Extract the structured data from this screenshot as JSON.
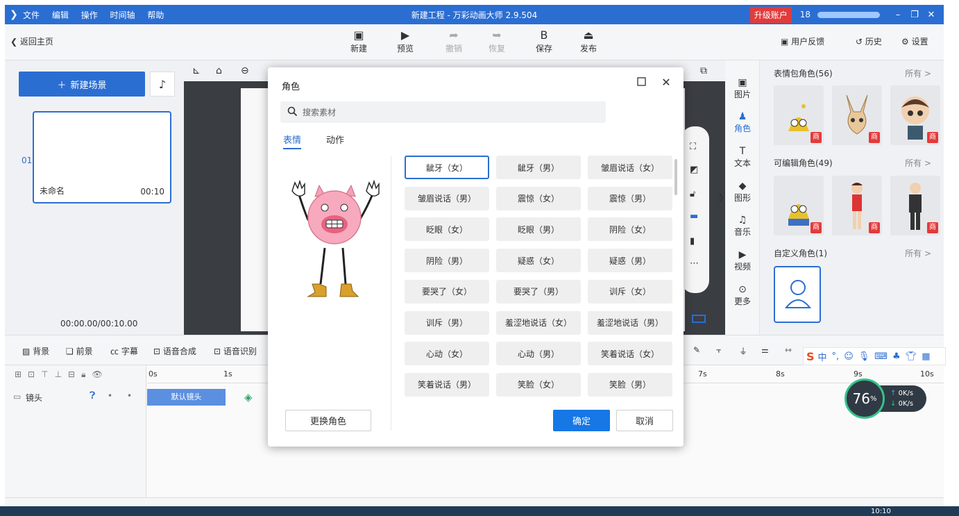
{
  "titlebar": {
    "menu": [
      "文件",
      "编辑",
      "操作",
      "时间轴",
      "帮助"
    ],
    "title": "新建工程 - 万彩动画大师 2.9.504",
    "upgrade": "升级账户",
    "phone": "18"
  },
  "toolbar": {
    "back": "返回主页",
    "tools": [
      {
        "label": "新建",
        "icon": "new-file-icon"
      },
      {
        "label": "预览",
        "icon": "play-icon"
      },
      {
        "label": "撤销",
        "icon": "undo-icon"
      },
      {
        "label": "恢复",
        "icon": "redo-icon"
      },
      {
        "label": "保存",
        "icon": "save-icon"
      },
      {
        "label": "发布",
        "icon": "publish-icon"
      }
    ],
    "feedback": "用户反馈",
    "history": "历史",
    "settings": "设置"
  },
  "scene_panel": {
    "new_scene": "新建场景",
    "scene_number": "01",
    "scene_name": "未命名",
    "scene_duration": "00:10",
    "timecode": "00:00.00/00:10.00"
  },
  "icon_strip": [
    "图片",
    "角色",
    "文本",
    "图形",
    "音乐",
    "视频",
    "更多"
  ],
  "library": {
    "section1": "表情包角色(56)",
    "section2": "可编辑角色(49)",
    "section3": "自定义角色(1)",
    "all": "所有 >",
    "shop_badge": "商"
  },
  "timeline": {
    "tools": [
      "背景",
      "前景",
      "字幕",
      "语音合成",
      "语音识别"
    ],
    "ticks": [
      "0s",
      "1s",
      "7s",
      "8s",
      "9s",
      "10s"
    ],
    "camera_row": "镜头",
    "camera_clip": "默认镜头"
  },
  "ime": {
    "lang": "中"
  },
  "speed": {
    "percent": "76",
    "unit": "%",
    "up": "0K/s",
    "down": "0K/s"
  },
  "dialog": {
    "title": "角色",
    "search_placeholder": "搜索素材",
    "tabs": [
      "表情",
      "动作"
    ],
    "expressions": [
      "龇牙（女）",
      "龇牙（男）",
      "皱眉说话（女）",
      "皱眉说话（男）",
      "震惊（女）",
      "震惊（男）",
      "眨眼（女）",
      "眨眼（男）",
      "阴险（女）",
      "阴险（男）",
      "疑惑（女）",
      "疑惑（男）",
      "要哭了（女）",
      "要哭了（男）",
      "训斥（女）",
      "训斥（男）",
      "羞涩地说话（女）",
      "羞涩地说话（男）",
      "心动（女）",
      "心动（男）",
      "笑着说话（女）",
      "笑着说话（男）",
      "笑脸（女）",
      "笑脸（男）"
    ],
    "selected_index": 0,
    "replace_button": "更换角色",
    "ok_button": "确定",
    "cancel_button": "取消"
  },
  "taskbar": {
    "clock": "10:10"
  }
}
